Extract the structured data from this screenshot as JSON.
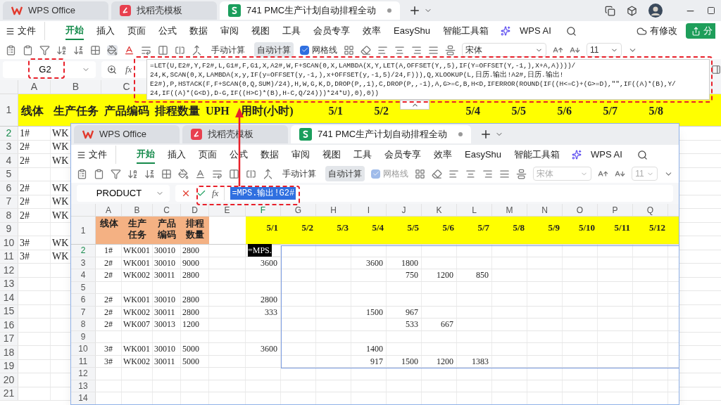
{
  "app": {
    "tabs": [
      {
        "label": "WPS Office",
        "kind": "wps",
        "selected": false
      },
      {
        "label": "找稻壳模板",
        "kind": "docer",
        "selected": false
      },
      {
        "label": "741 PMC生产计划自动排程全动",
        "kind": "sheet",
        "selected": true
      }
    ],
    "menu": [
      {
        "label": "文件",
        "selected": false
      },
      {
        "label": "开始",
        "selected": true
      },
      {
        "label": "插入",
        "selected": false
      },
      {
        "label": "页面",
        "selected": false
      },
      {
        "label": "公式",
        "selected": false
      },
      {
        "label": "数据",
        "selected": false
      },
      {
        "label": "审阅",
        "selected": false
      },
      {
        "label": "视图",
        "selected": false
      },
      {
        "label": "工具",
        "selected": false
      },
      {
        "label": "会员专享",
        "selected": false
      },
      {
        "label": "效率",
        "selected": false
      },
      {
        "label": "EasyShu",
        "selected": false
      },
      {
        "label": "智能工具箱",
        "selected": false
      },
      {
        "label": "WPS AI",
        "selected": false
      }
    ],
    "save_status": "有修改",
    "share_button": "分",
    "toolbar": {
      "disabled": false,
      "calc_buttons": [
        {
          "label": "手动计算",
          "selected": false
        },
        {
          "label": "自动计算",
          "selected": true
        }
      ],
      "gridlines": {
        "label": "网格线",
        "checked": true
      },
      "font": "宋体",
      "font_size": "11"
    },
    "formula_bar": {
      "name_box": "G2",
      "fx_label": "fx",
      "formula_lines": [
        "=LET(U,E2#,Y,F2#,L,G1#,F,G1,X,A2#,W,F+SCAN(0,X,LAMBDA(X,Y,LET(A,OFFSET(Y,,5),IF(Y=OFFSET(Y,-1,),X+A,A))))/",
        "24,K,SCAN(0,X,LAMBDA(x,y,IF(y=OFFSET(y,-1,),x+OFFSET(y,-1,5)/24,F))),Q,XLOOKUP(L,日历.输出!A2#,日历.输出!",
        "E2#),P,HSTACK(F,F+SCAN(0,Q,SUM)/24),H,W,G,K,D,DROP(P,,1),C,DROP(P,,-1),A,G>=C,B,H<D,IFERROR(ROUND(IF((H<=C)+(G>=D),\"\",IF((A)*(B),Y/",
        "24,IF((A)*(G<D),D-G,IF((H>C)*(B),H-C,Q/24)))*24*U),0),0))"
      ]
    },
    "sheet": {
      "columns": [
        {
          "label": "A",
          "selected": false
        },
        {
          "label": "B",
          "selected": false
        },
        {
          "label": "C",
          "selected": false
        }
      ],
      "header_row_number": "1",
      "header_row": [
        {
          "text": "线体",
          "color": "#ffff00"
        },
        {
          "text": "生产任务",
          "color": "#ffff00"
        },
        {
          "text": "产品编码",
          "color": "#ffff00"
        },
        {
          "text": "排程数量",
          "color": "#ffff00"
        },
        {
          "text": "UPH",
          "color": "#ffff00"
        },
        {
          "text": "用时(小时)",
          "color": "#ffff00"
        },
        {
          "text": "5/1",
          "color": "#ffff00"
        },
        {
          "text": "5/2",
          "color": "#ffff00"
        },
        {
          "color": "#ffff00"
        },
        {
          "text": "5/4",
          "color": "#ffff00"
        },
        {
          "text": "5/5",
          "color": "#ffff00"
        },
        {
          "text": "5/6",
          "color": "#ffff00"
        },
        {
          "text": "5/7",
          "color": "#ffff00"
        },
        {
          "text": "5/8",
          "color": "#ffff00"
        }
      ],
      "rows": [
        {
          "number": "2",
          "selected": true,
          "cells": [
            "1#",
            "WK"
          ]
        },
        {
          "number": "3",
          "selected": false,
          "cells": [
            "2#",
            "WK"
          ]
        },
        {
          "number": "4",
          "selected": false,
          "cells": [
            "2#",
            "WK"
          ]
        },
        {
          "number": "5",
          "selected": false
        },
        {
          "number": "6",
          "selected": false,
          "cells": [
            "2#",
            "WK"
          ]
        },
        {
          "number": "7",
          "selected": false,
          "cells": [
            "2#",
            "WK"
          ]
        },
        {
          "number": "8",
          "selected": false,
          "cells": [
            "2#",
            "WK"
          ]
        },
        {
          "number": "9",
          "selected": false
        },
        {
          "number": "10",
          "selected": false,
          "cells": [
            "3#",
            "WK"
          ]
        },
        {
          "number": "11",
          "selected": false,
          "cells": [
            "3#",
            "WK"
          ]
        },
        {
          "number": "12",
          "selected": false
        },
        {
          "number": "13",
          "selected": false
        },
        {
          "number": "14",
          "selected": false
        },
        {
          "number": "15",
          "selected": false
        },
        {
          "number": "16",
          "selected": false
        },
        {
          "number": "17",
          "selected": false
        },
        {
          "number": "18",
          "selected": false
        },
        {
          "number": "19",
          "selected": false
        },
        {
          "number": "20",
          "selected": false
        },
        {
          "number": "21",
          "selected": false
        }
      ]
    }
  },
  "front_window": {
    "tabs": [
      {
        "label": "WPS Office",
        "kind": "wps",
        "selected": false
      },
      {
        "label": "找稻壳模板",
        "kind": "docer",
        "selected": false
      },
      {
        "label": "741 PMC生产计划自动排程全动",
        "kind": "sheet",
        "selected": true
      }
    ],
    "menu": [
      {
        "label": "文件",
        "selected": false
      },
      {
        "label": "开始",
        "selected": true
      },
      {
        "label": "插入",
        "selected": false
      },
      {
        "label": "页面",
        "selected": false
      },
      {
        "label": "公式",
        "selected": false
      },
      {
        "label": "数据",
        "selected": false
      },
      {
        "label": "审阅",
        "selected": false
      },
      {
        "label": "视图",
        "selected": false
      },
      {
        "label": "工具",
        "selected": false
      },
      {
        "label": "会员专享",
        "selected": false
      },
      {
        "label": "效率",
        "selected": false
      },
      {
        "label": "EasyShu",
        "selected": false
      },
      {
        "label": "智能工具箱",
        "selected": false
      },
      {
        "label": "WPS AI",
        "selected": false
      }
    ],
    "toolbar": {
      "disabled": true,
      "calc_buttons": [
        {
          "label": "手动计算",
          "selected": false
        },
        {
          "label": "自动计算",
          "selected": true
        }
      ],
      "gridlines": {
        "label": "网格线",
        "checked": true
      },
      "font": "宋体",
      "font_size": "11"
    },
    "formula_bar": {
      "name_box": "PRODUCT",
      "fx_label": "fx",
      "formula": "=MPS.输出!G2#"
    },
    "sheet": {
      "columns": [
        {
          "label": "A",
          "selected": false
        },
        {
          "label": "B",
          "selected": false
        },
        {
          "label": "C",
          "selected": false
        },
        {
          "label": "D",
          "selected": false
        },
        {
          "label": "E",
          "selected": false
        },
        {
          "label": "F",
          "selected": true
        },
        {
          "label": "G",
          "selected": false
        },
        {
          "label": "H",
          "selected": false
        },
        {
          "label": "I",
          "selected": false
        },
        {
          "label": "J",
          "selected": false
        },
        {
          "label": "K",
          "selected": false
        },
        {
          "label": "L",
          "selected": false
        },
        {
          "label": "M",
          "selected": false
        },
        {
          "label": "N",
          "selected": false
        },
        {
          "label": "O",
          "selected": false
        },
        {
          "label": "P",
          "selected": false
        },
        {
          "label": "Q",
          "selected": false
        }
      ],
      "header_row_number": "1",
      "header_row": [
        {
          "text": "线体",
          "color": "#f4b183"
        },
        {
          "text": "生产任务",
          "color": "#f4b183"
        },
        {
          "text": "产品编码",
          "color": "#f4b183"
        },
        {
          "text": "排程数量",
          "color": "#f4b183"
        },
        {
          "text": "5/1",
          "color": "#ffff00"
        },
        {
          "text": "5/2",
          "color": "#ffff00"
        },
        {
          "text": "5/3",
          "color": "#ffff00"
        },
        {
          "text": "5/4",
          "color": "#ffff00"
        },
        {
          "text": "5/5",
          "color": "#ffff00"
        },
        {
          "text": "5/6",
          "color": "#ffff00"
        },
        {
          "text": "5/7",
          "color": "#ffff00"
        },
        {
          "text": "5/8",
          "color": "#ffff00"
        },
        {
          "text": "5/9",
          "color": "#ffff00"
        },
        {
          "text": "5/10",
          "color": "#ffff00"
        },
        {
          "text": "5/11",
          "color": "#ffff00"
        },
        {
          "text": "5/12",
          "color": "#ffff00"
        }
      ],
      "editor": {
        "text": "=MPS."
      },
      "rows": [
        {
          "number": "2",
          "selected": true,
          "cells": [
            "1#",
            "WK001",
            "30010",
            "2800"
          ]
        },
        {
          "number": "3",
          "selected": false,
          "cells": [
            "2#",
            "WK001",
            "30010",
            "9000",
            null,
            "3600",
            null,
            null,
            "3600",
            "1800"
          ]
        },
        {
          "number": "4",
          "selected": false,
          "cells": [
            "2#",
            "WK002",
            "30011",
            "2800",
            null,
            null,
            null,
            null,
            null,
            "750",
            "1200",
            "850"
          ]
        },
        {
          "number": "5",
          "selected": false
        },
        {
          "number": "6",
          "selected": false,
          "cells": [
            "2#",
            "WK001",
            "30010",
            "2800",
            null,
            "2800"
          ]
        },
        {
          "number": "7",
          "selected": false,
          "cells": [
            "2#",
            "WK002",
            "30011",
            "2800",
            null,
            "333",
            null,
            null,
            "1500",
            "967"
          ]
        },
        {
          "number": "8",
          "selected": false,
          "cells": [
            "2#",
            "WK007",
            "30013",
            "1200",
            null,
            null,
            null,
            null,
            null,
            "533",
            "667"
          ]
        },
        {
          "number": "9",
          "selected": false
        },
        {
          "number": "10",
          "selected": false,
          "cells": [
            "3#",
            "WK001",
            "30010",
            "5000",
            null,
            "3600",
            null,
            null,
            "1400"
          ]
        },
        {
          "number": "11",
          "selected": false,
          "cells": [
            "3#",
            "WK002",
            "30011",
            "5000",
            null,
            null,
            null,
            null,
            "917",
            "1500",
            "1200",
            "1383"
          ]
        },
        {
          "number": "12",
          "selected": false
        },
        {
          "number": "13",
          "selected": false
        },
        {
          "number": "14",
          "selected": false
        }
      ]
    }
  }
}
